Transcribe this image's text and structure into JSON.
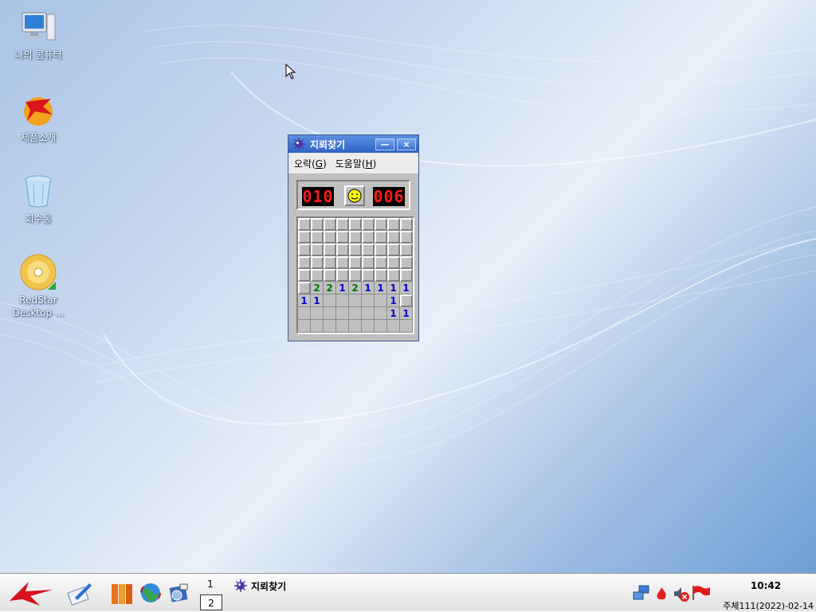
{
  "desktop": {
    "icons": [
      {
        "label": "나의 콤퓨터",
        "icon": "computer-icon"
      },
      {
        "label": "제품소개",
        "icon": "product-intro-icon"
      },
      {
        "label": "회수통",
        "icon": "trash-icon"
      },
      {
        "label": "RedStar Desktop ...",
        "icon": "dvd-icon"
      }
    ]
  },
  "window": {
    "title": "지뢰찾기",
    "minimize_label": "—",
    "close_label": "×",
    "menu": [
      {
        "text": "오락(",
        "key": "G",
        "end": ")"
      },
      {
        "text": "도움말(",
        "key": "H",
        "end": ")"
      }
    ],
    "mine_counter": "010",
    "timer": "006",
    "board": {
      "cols": 9,
      "rows": 9,
      "cells": [
        "#########",
        "#########",
        "#########",
        "#########",
        "#########",
        "#22121111",
        "11     1#",
        "       11",
        "         "
      ]
    }
  },
  "colors": {
    "n1": "#0000cc",
    "n2": "#007b00",
    "led": "#ff1a1a",
    "titlebar": "#2f62c4"
  },
  "taskbar": {
    "pager": [
      "1",
      "2"
    ],
    "task_label": "지뢰찾기",
    "clock": "10:42",
    "date": "주체111(2022)-02-14",
    "tray_icons": [
      "network-icon",
      "fire-icon",
      "volume-muted-icon",
      "flag-icon"
    ]
  }
}
